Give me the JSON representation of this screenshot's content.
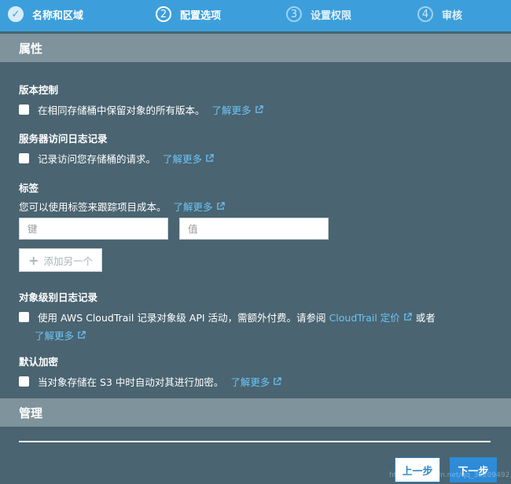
{
  "steps": [
    {
      "number": "✓",
      "label": "名称和区域",
      "state": "done"
    },
    {
      "number": "2",
      "label": "配置选项",
      "state": "active"
    },
    {
      "number": "3",
      "label": "设置权限",
      "state": "pending"
    },
    {
      "number": "4",
      "label": "审核",
      "state": "pending"
    }
  ],
  "properties_header": "属性",
  "versioning": {
    "title": "版本控制",
    "text": "在相同存储桶中保留对象的所有版本。",
    "link": "了解更多"
  },
  "server_logging": {
    "title": "服务器访问日志记录",
    "text": "记录访问您存储桶的请求。",
    "link": "了解更多"
  },
  "tags": {
    "title": "标签",
    "text": "您可以使用标签来跟踪项目成本。",
    "link": "了解更多",
    "key_placeholder": "键",
    "value_placeholder": "值",
    "add_label": "添加另一个"
  },
  "object_logging": {
    "title": "对象级别日志记录",
    "text_prefix": "使用 AWS CloudTrail 记录对象级 API 活动，需额外付费。请参阅",
    "pricing_link": "CloudTrail 定价",
    "text_or": "或者",
    "link": "了解更多"
  },
  "encryption": {
    "title": "默认加密",
    "text": "当对象存储在 S3 中时自动对其进行加密。",
    "link": "了解更多"
  },
  "management_header": "管理",
  "buttons": {
    "prev": "上一步",
    "next": "下一步"
  },
  "watermark": "http://blog.csdn.net/qq_39209492",
  "colors": {
    "accent": "#3c9fdb",
    "link": "#6cc4f5",
    "background": "#4a6471",
    "header": "#7e939c"
  }
}
